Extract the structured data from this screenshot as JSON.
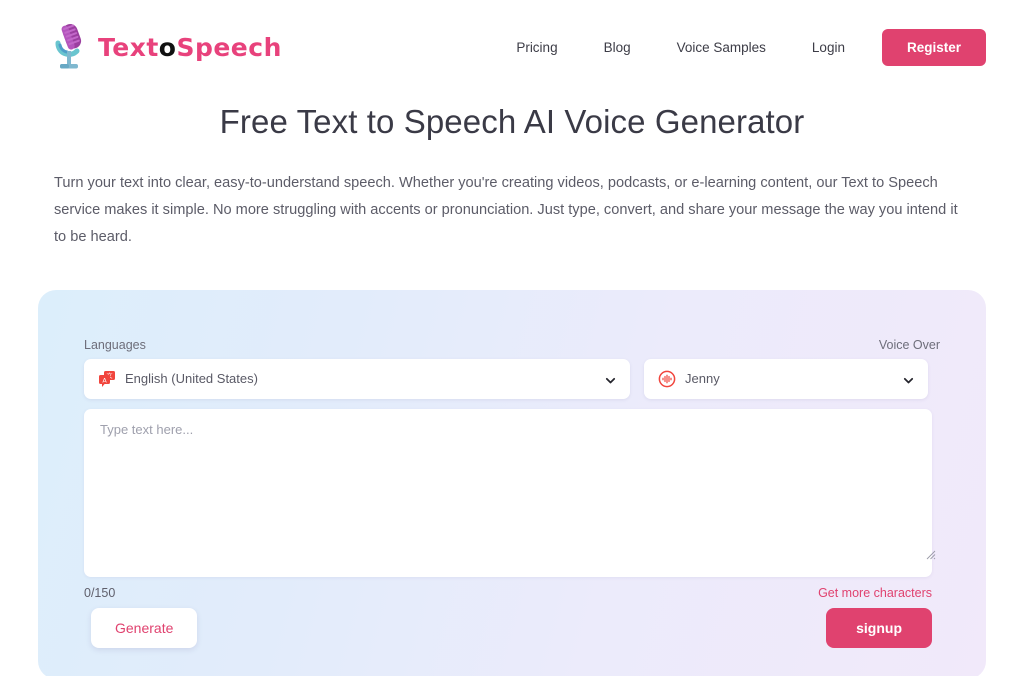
{
  "brand": {
    "name_part1": "Text",
    "name_mid": "o",
    "name_part2": "Speech",
    "logo_icon": "microphone-icon"
  },
  "nav": {
    "links": [
      {
        "label": "Pricing"
      },
      {
        "label": "Blog"
      },
      {
        "label": "Voice Samples"
      },
      {
        "label": "Login"
      }
    ],
    "cta_label": "Register"
  },
  "hero": {
    "title": "Free Text to Speech AI Voice Generator",
    "subtitle": "Turn your text into clear, easy-to-understand speech. Whether you're creating videos, podcasts, or e-learning content, our Text to Speech service makes it simple. No more struggling with accents or pronunciation. Just type, convert, and share your message the way you intend it to be heard."
  },
  "tool": {
    "language": {
      "label": "Languages",
      "selected": "English (United States)",
      "icon": "translate-icon",
      "chevron": "chevron-down-icon"
    },
    "voice": {
      "label": "Voice Over",
      "selected": "Jenny",
      "icon": "audio-wave-icon",
      "chevron": "chevron-down-icon"
    },
    "textarea": {
      "placeholder": "Type text here...",
      "value": ""
    },
    "char_count": "0/150",
    "get_more_label": "Get more characters",
    "generate_label": "Generate",
    "signup_label": "signup"
  },
  "colors": {
    "accent_pink": "#e0426f",
    "icon_red": "#f1453d",
    "card_gradient_start": "#dceefb",
    "card_gradient_end": "#f1e9fa",
    "text_dark": "#3a3a46"
  }
}
